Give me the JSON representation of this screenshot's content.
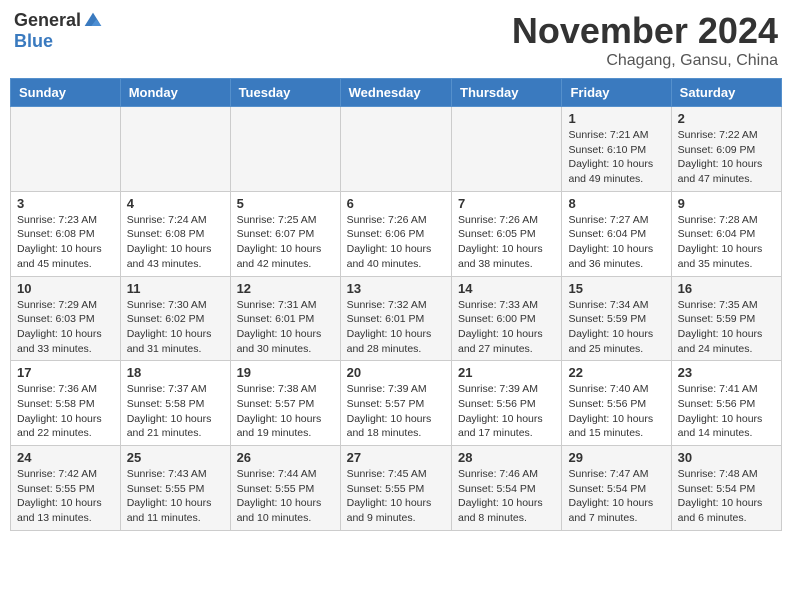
{
  "header": {
    "logo_general": "General",
    "logo_blue": "Blue",
    "month_title": "November 2024",
    "location": "Chagang, Gansu, China"
  },
  "weekdays": [
    "Sunday",
    "Monday",
    "Tuesday",
    "Wednesday",
    "Thursday",
    "Friday",
    "Saturday"
  ],
  "weeks": [
    [
      {
        "day": "",
        "info": ""
      },
      {
        "day": "",
        "info": ""
      },
      {
        "day": "",
        "info": ""
      },
      {
        "day": "",
        "info": ""
      },
      {
        "day": "",
        "info": ""
      },
      {
        "day": "1",
        "info": "Sunrise: 7:21 AM\nSunset: 6:10 PM\nDaylight: 10 hours\nand 49 minutes."
      },
      {
        "day": "2",
        "info": "Sunrise: 7:22 AM\nSunset: 6:09 PM\nDaylight: 10 hours\nand 47 minutes."
      }
    ],
    [
      {
        "day": "3",
        "info": "Sunrise: 7:23 AM\nSunset: 6:08 PM\nDaylight: 10 hours\nand 45 minutes."
      },
      {
        "day": "4",
        "info": "Sunrise: 7:24 AM\nSunset: 6:08 PM\nDaylight: 10 hours\nand 43 minutes."
      },
      {
        "day": "5",
        "info": "Sunrise: 7:25 AM\nSunset: 6:07 PM\nDaylight: 10 hours\nand 42 minutes."
      },
      {
        "day": "6",
        "info": "Sunrise: 7:26 AM\nSunset: 6:06 PM\nDaylight: 10 hours\nand 40 minutes."
      },
      {
        "day": "7",
        "info": "Sunrise: 7:26 AM\nSunset: 6:05 PM\nDaylight: 10 hours\nand 38 minutes."
      },
      {
        "day": "8",
        "info": "Sunrise: 7:27 AM\nSunset: 6:04 PM\nDaylight: 10 hours\nand 36 minutes."
      },
      {
        "day": "9",
        "info": "Sunrise: 7:28 AM\nSunset: 6:04 PM\nDaylight: 10 hours\nand 35 minutes."
      }
    ],
    [
      {
        "day": "10",
        "info": "Sunrise: 7:29 AM\nSunset: 6:03 PM\nDaylight: 10 hours\nand 33 minutes."
      },
      {
        "day": "11",
        "info": "Sunrise: 7:30 AM\nSunset: 6:02 PM\nDaylight: 10 hours\nand 31 minutes."
      },
      {
        "day": "12",
        "info": "Sunrise: 7:31 AM\nSunset: 6:01 PM\nDaylight: 10 hours\nand 30 minutes."
      },
      {
        "day": "13",
        "info": "Sunrise: 7:32 AM\nSunset: 6:01 PM\nDaylight: 10 hours\nand 28 minutes."
      },
      {
        "day": "14",
        "info": "Sunrise: 7:33 AM\nSunset: 6:00 PM\nDaylight: 10 hours\nand 27 minutes."
      },
      {
        "day": "15",
        "info": "Sunrise: 7:34 AM\nSunset: 5:59 PM\nDaylight: 10 hours\nand 25 minutes."
      },
      {
        "day": "16",
        "info": "Sunrise: 7:35 AM\nSunset: 5:59 PM\nDaylight: 10 hours\nand 24 minutes."
      }
    ],
    [
      {
        "day": "17",
        "info": "Sunrise: 7:36 AM\nSunset: 5:58 PM\nDaylight: 10 hours\nand 22 minutes."
      },
      {
        "day": "18",
        "info": "Sunrise: 7:37 AM\nSunset: 5:58 PM\nDaylight: 10 hours\nand 21 minutes."
      },
      {
        "day": "19",
        "info": "Sunrise: 7:38 AM\nSunset: 5:57 PM\nDaylight: 10 hours\nand 19 minutes."
      },
      {
        "day": "20",
        "info": "Sunrise: 7:39 AM\nSunset: 5:57 PM\nDaylight: 10 hours\nand 18 minutes."
      },
      {
        "day": "21",
        "info": "Sunrise: 7:39 AM\nSunset: 5:56 PM\nDaylight: 10 hours\nand 17 minutes."
      },
      {
        "day": "22",
        "info": "Sunrise: 7:40 AM\nSunset: 5:56 PM\nDaylight: 10 hours\nand 15 minutes."
      },
      {
        "day": "23",
        "info": "Sunrise: 7:41 AM\nSunset: 5:56 PM\nDaylight: 10 hours\nand 14 minutes."
      }
    ],
    [
      {
        "day": "24",
        "info": "Sunrise: 7:42 AM\nSunset: 5:55 PM\nDaylight: 10 hours\nand 13 minutes."
      },
      {
        "day": "25",
        "info": "Sunrise: 7:43 AM\nSunset: 5:55 PM\nDaylight: 10 hours\nand 11 minutes."
      },
      {
        "day": "26",
        "info": "Sunrise: 7:44 AM\nSunset: 5:55 PM\nDaylight: 10 hours\nand 10 minutes."
      },
      {
        "day": "27",
        "info": "Sunrise: 7:45 AM\nSunset: 5:55 PM\nDaylight: 10 hours\nand 9 minutes."
      },
      {
        "day": "28",
        "info": "Sunrise: 7:46 AM\nSunset: 5:54 PM\nDaylight: 10 hours\nand 8 minutes."
      },
      {
        "day": "29",
        "info": "Sunrise: 7:47 AM\nSunset: 5:54 PM\nDaylight: 10 hours\nand 7 minutes."
      },
      {
        "day": "30",
        "info": "Sunrise: 7:48 AM\nSunset: 5:54 PM\nDaylight: 10 hours\nand 6 minutes."
      }
    ]
  ]
}
